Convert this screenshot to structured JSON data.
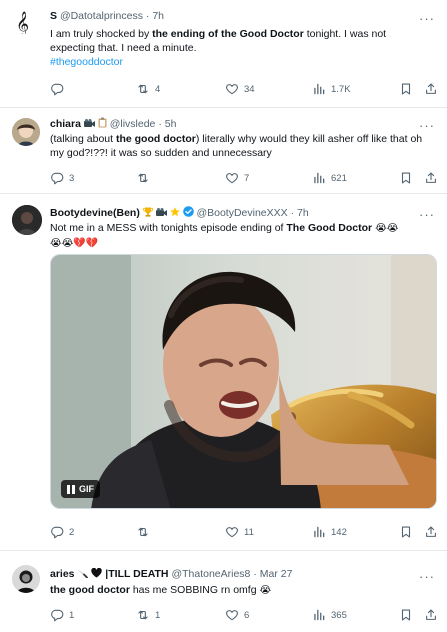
{
  "tweets": [
    {
      "display_name": "S",
      "handle": "@Datotalprincess",
      "sep": "·",
      "time": "7h",
      "more": "···",
      "text_parts": [
        "I am truly shocked by ",
        "the ending of the Good Doctor",
        " tonight. I was not expecting that. I need a minute."
      ],
      "hashtag": "#thegooddoctor",
      "avatar_icon": "treble-clef-icon",
      "stats": {
        "replies": "",
        "retweets": "4",
        "likes": "34",
        "views": "1.7K"
      }
    },
    {
      "display_name": "chiara",
      "handle": "@livslede",
      "sep": "·",
      "time": "5h",
      "more": "···",
      "text_parts": [
        "(talking about ",
        "the good doctor",
        ") literally why would they kill asher off like that oh my god?!??! it was so sudden and unnecessary"
      ],
      "stats": {
        "replies": "3",
        "retweets": "",
        "likes": "7",
        "views": "621"
      }
    },
    {
      "display_name": "Bootydevine(Ben)",
      "handle": "@BootyDevineXXX",
      "sep": "·",
      "time": "7h",
      "more": "···",
      "text_parts": [
        "Not me in a MESS with tonights episode ending of ",
        "The Good Doctor",
        " "
      ],
      "emoji_line": "😭😭💔💔",
      "media_label": "GIF",
      "stats": {
        "replies": "2",
        "retweets": "",
        "likes": "11",
        "views": "142"
      }
    },
    {
      "display_name": "aries",
      "name_suffix": "|TILL DEATH",
      "handle": "@ThatoneAries8",
      "sep": "·",
      "time": "Mar 27",
      "more": "···",
      "text_parts": [
        "the good doctor",
        " has me SOBBING rn omfg "
      ],
      "stats": {
        "replies": "1",
        "retweets": "1",
        "likes": "6",
        "views": "365"
      }
    }
  ],
  "colors": {
    "text": "#0f1419",
    "muted": "#536471",
    "link": "#1d9bf0",
    "verified": "#1d9bf0",
    "divider": "#e6e9eb"
  },
  "icons": [
    "reply-icon",
    "retweet-icon",
    "like-icon",
    "views-icon",
    "bookmark-icon",
    "share-icon"
  ]
}
